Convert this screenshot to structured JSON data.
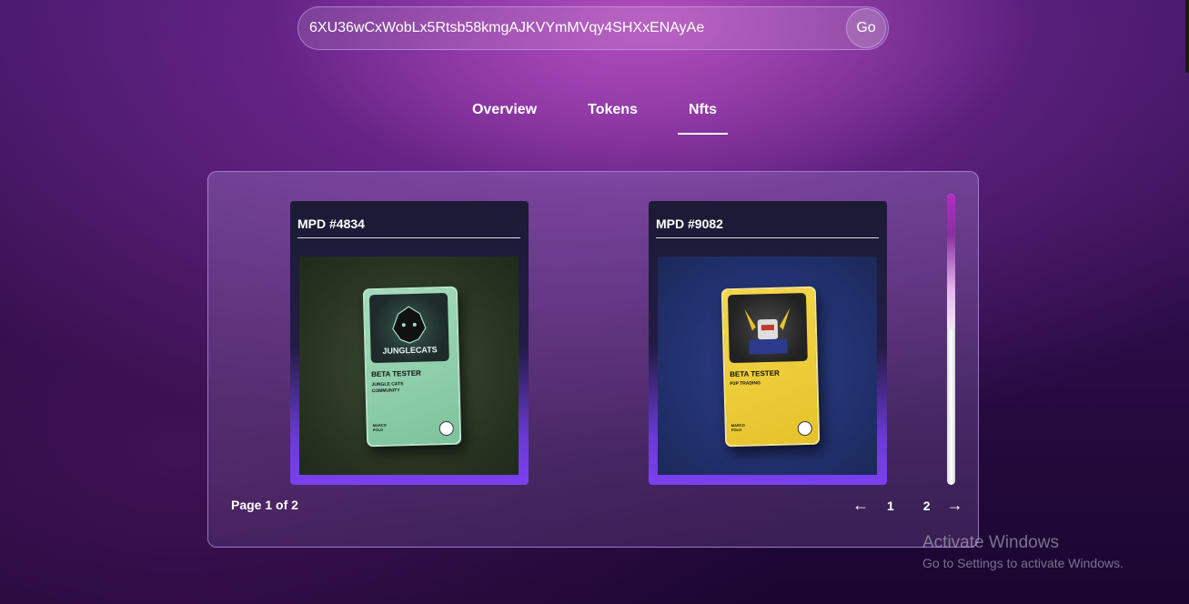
{
  "search": {
    "value": "6XU36wCxWobLx5Rtsb58kmgAJKVYmMVqy4SHXxENAyAe",
    "go_label": "Go"
  },
  "tabs": [
    {
      "label": "Overview",
      "active": false
    },
    {
      "label": "Tokens",
      "active": false
    },
    {
      "label": "Nfts",
      "active": true
    }
  ],
  "nfts": [
    {
      "title": "MPD #4834",
      "art": {
        "logo_text": "JUNGLECATS",
        "badge": "BETA TESTER",
        "subtitle": "JUNGLE CATS COMMUNITY",
        "brand": "MARCO POLO"
      }
    },
    {
      "title": "MPD #9082",
      "art": {
        "badge": "BETA TESTER",
        "subtitle": "P2P TRADING",
        "brand": "MARCO POLO"
      }
    }
  ],
  "pagination": {
    "label": "Page 1 of 2",
    "prev": "←",
    "next": "→",
    "pages": [
      "1",
      "2"
    ],
    "current": 1,
    "total": 2
  },
  "watermark": {
    "title": "Activate Windows",
    "subtitle": "Go to Settings to activate Windows."
  }
}
